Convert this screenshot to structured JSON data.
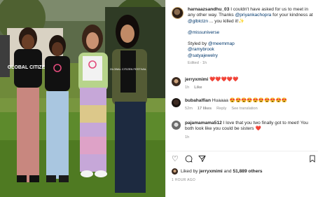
{
  "post": {
    "username": "harnaazsandhu_03",
    "caption_lines": [
      " I couldn't have asked for us to meet in any other way. Thanks ",
      "@priyankachopra",
      " for your kindness at ",
      "@glblctzn",
      " ... you killed it!✨"
    ],
    "tag_miss_universe": "@missuniverse",
    "styled_by": "Styled by ",
    "tags": [
      "@meemmap",
      "@ramybrook",
      "@satyajewelry"
    ],
    "edited": "Edited · 1h",
    "photo_tshirt_text_1": "GLOBAL CITIZEN",
    "photo_tshirt_text_2": "GLOBAL CITIZEN FESTIVAL"
  },
  "comments": [
    {
      "username": "jerryxmimi",
      "text": "❤️❤️❤️❤️❤️",
      "time": "1h",
      "likes": "",
      "reply": "Like",
      "translation": ""
    },
    {
      "username": "bubahalfian",
      "text": "Huaaaa 😍😍😍😍😍😍😍😍😍😍",
      "time": "52m",
      "likes": "17 likes",
      "reply": "Reply",
      "translation": "See translation"
    },
    {
      "username": "pajamamama512",
      "text": " I love that you two finally got to meet! You both look like you could be sisters ",
      "heart": "❤️",
      "time": "1h",
      "likes": "",
      "reply": "",
      "translation": ""
    }
  ],
  "actions": {
    "like_icon": "heart-outline-icon",
    "comment_icon": "comment-icon",
    "share_icon": "paper-plane-icon",
    "save_icon": "bookmark-icon"
  },
  "likes": {
    "prefix": "Liked by ",
    "user": "jerryxmimi",
    "joiner": " and ",
    "others": "51,889 others"
  },
  "timestamp": "1 HOUR AGO",
  "colors": {
    "link": "#00376b",
    "muted": "#8e8e8e",
    "heart": "#e0245e"
  }
}
